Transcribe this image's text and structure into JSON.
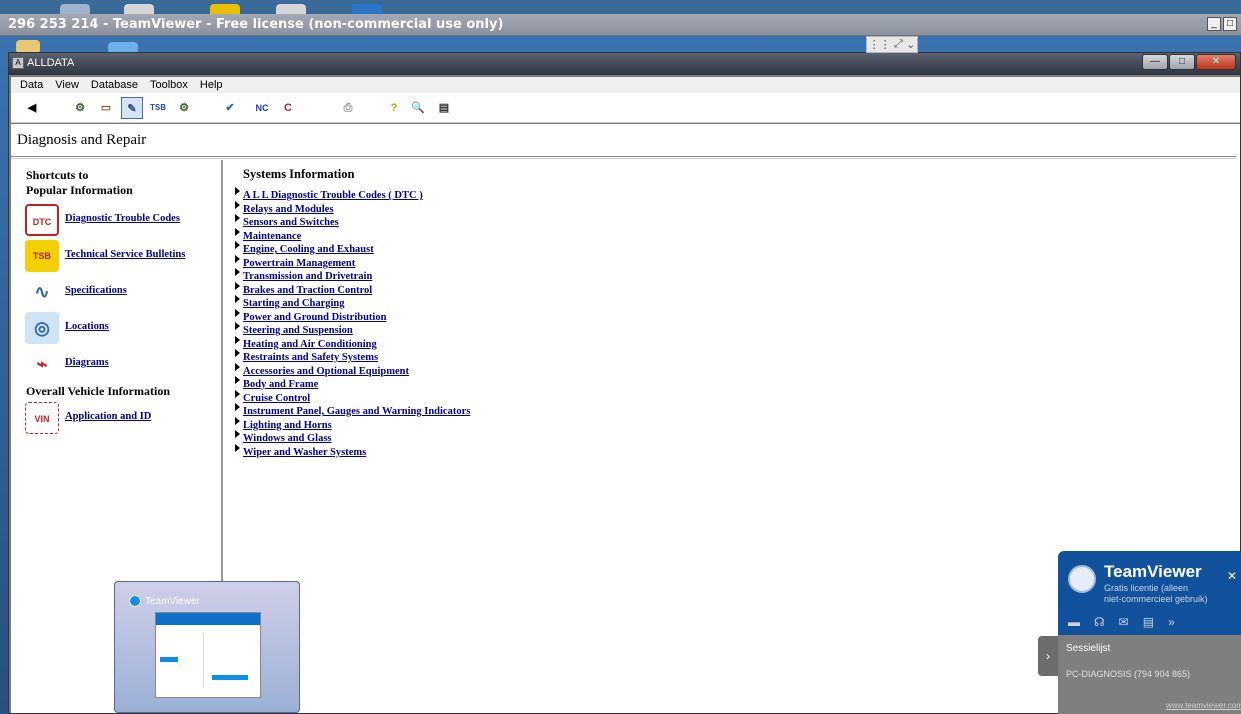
{
  "teamviewer": {
    "title": "296 253 214 - TeamViewer - Free license (non-commercial use only)",
    "btn_min": "_",
    "btn_max": "□",
    "handle_icons": [
      "⋮⋮",
      "⤢",
      "⌄"
    ]
  },
  "alldata": {
    "window_title": "ALLDATA",
    "btn_min": "—",
    "btn_max": "□",
    "btn_close": "✕",
    "menu": [
      "Data",
      "View",
      "Database",
      "Toolbox",
      "Help"
    ],
    "toolbar": [
      {
        "name": "back-icon",
        "glyph": "◀"
      },
      {
        "name": "vehicle-icon",
        "glyph": "⚙"
      },
      {
        "name": "folder-icon",
        "glyph": "▭"
      },
      {
        "name": "repair-icon",
        "glyph": "✎"
      },
      {
        "name": "tsb-icon",
        "glyph": "TSB"
      },
      {
        "name": "settings-icon",
        "glyph": "⚙"
      },
      {
        "name": "labor-icon",
        "glyph": "✔"
      },
      {
        "name": "new-car-icon",
        "glyph": "NC"
      },
      {
        "name": "car-icon",
        "glyph": "C"
      },
      {
        "name": "print-icon",
        "glyph": "⎙"
      },
      {
        "name": "help-icon",
        "glyph": "?"
      },
      {
        "name": "search-icon",
        "glyph": "🔍"
      },
      {
        "name": "printer-icon",
        "glyph": "▤"
      }
    ],
    "page_title": "Diagnosis and Repair",
    "shortcuts_heading_1": "Shortcuts to",
    "shortcuts_heading_2": "Popular Information",
    "shortcuts": [
      {
        "label": "Diagnostic Trouble Codes",
        "icon": "DTC",
        "color": "#c82020"
      },
      {
        "label": "Technical Service Bulletins",
        "icon": "TSB",
        "color": "#e0b000"
      },
      {
        "label": "Specifications",
        "icon": "∿",
        "color": "#2b6aa8"
      },
      {
        "label": "Locations",
        "icon": "◎",
        "color": "#2b6aa8"
      },
      {
        "label": "Diagrams",
        "icon": "⌁",
        "color": "#c82020"
      }
    ],
    "overall_heading": "Overall Vehicle Information",
    "overall": [
      {
        "label": "Application and ID",
        "icon": "VIN",
        "color": "#c82020"
      }
    ],
    "systems_heading": "Systems Information",
    "systems": [
      "A L L  Diagnostic Trouble Codes ( DTC )",
      "Relays and Modules",
      "Sensors and Switches",
      "Maintenance",
      "Engine, Cooling and Exhaust",
      "Powertrain Management",
      "Transmission and Drivetrain",
      "Brakes and Traction Control",
      "Starting and Charging",
      "Power and Ground Distribution",
      "Steering and Suspension",
      "Heating and Air Conditioning",
      "Restraints and Safety Systems",
      "Accessories and Optional Equipment",
      "Body and Frame",
      "Cruise Control",
      "Instrument Panel, Gauges and Warning Indicators",
      "Lighting and Horns",
      "Windows and Glass",
      "Wiper and Washer Systems"
    ]
  },
  "tv_thumbnail": {
    "title": "TeamViewer"
  },
  "tv_panel": {
    "name": "TeamViewer",
    "sub_1": "Gratis licentie (alleen",
    "sub_2": "niet-commercieel gebruik)",
    "session_label": "Sessielijst",
    "pc_name": "PC-DIAGNOSIS (794 904 865)",
    "link": "www.teamviewer.com",
    "tab_glyph": "›",
    "close_glyph": "✕",
    "icons": [
      "▬",
      "☊",
      "✉",
      "▤",
      "»"
    ]
  }
}
